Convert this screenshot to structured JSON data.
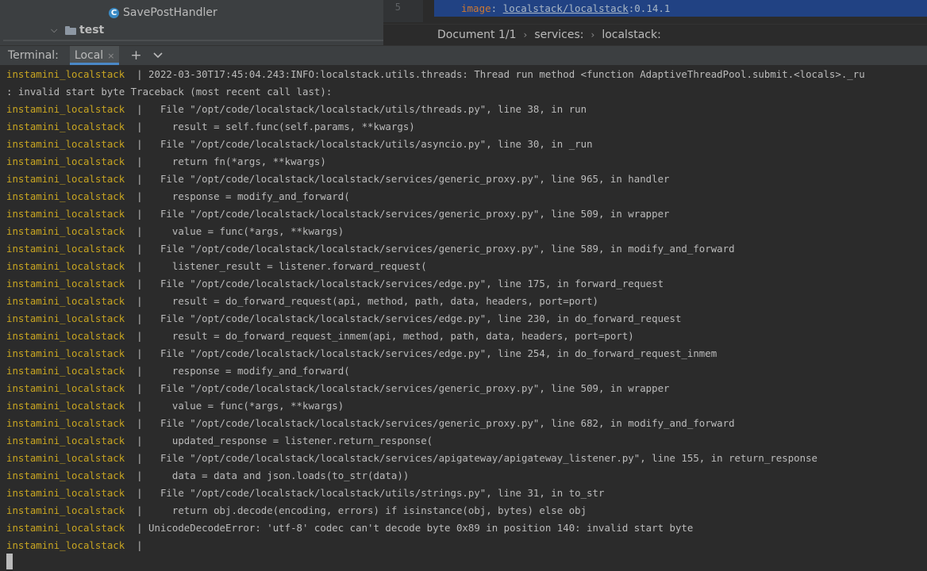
{
  "project_tree": {
    "class_item": {
      "icon": "class-icon",
      "glyph": "C",
      "label": "SavePostHandler"
    },
    "folder_item": {
      "icon": "folder-icon",
      "label": "test"
    }
  },
  "editor": {
    "line_number": "5",
    "code": {
      "key": "image",
      "colon": ":",
      "link": "localstack/localstack",
      "rest": ":0.14.1"
    },
    "breadcrumb": [
      "Document 1/1",
      "services:",
      "localstack:"
    ]
  },
  "terminal_header": {
    "title": "Terminal:",
    "tab_label": "Local",
    "close_glyph": "×",
    "add_glyph": "+",
    "dropdown_glyph": "⌄"
  },
  "colors": {
    "container_name": "#c8a521",
    "tab_underline": "#4a88c7",
    "editor_selection": "#214283"
  },
  "terminal_lines": [
    {
      "name": "instamini_localstack",
      "text": "  | 2022-03-30T17:45:04.243:INFO:localstack.utils.threads: Thread run method <function AdaptiveThreadPool.submit.<locals>._ru"
    },
    {
      "name": "",
      "text": ": invalid start byte Traceback (most recent call last):"
    },
    {
      "name": "instamini_localstack",
      "text": "  |   File \"/opt/code/localstack/localstack/utils/threads.py\", line 38, in run"
    },
    {
      "name": "instamini_localstack",
      "text": "  |     result = self.func(self.params, **kwargs)"
    },
    {
      "name": "instamini_localstack",
      "text": "  |   File \"/opt/code/localstack/localstack/utils/asyncio.py\", line 30, in _run"
    },
    {
      "name": "instamini_localstack",
      "text": "  |     return fn(*args, **kwargs)"
    },
    {
      "name": "instamini_localstack",
      "text": "  |   File \"/opt/code/localstack/localstack/services/generic_proxy.py\", line 965, in handler"
    },
    {
      "name": "instamini_localstack",
      "text": "  |     response = modify_and_forward("
    },
    {
      "name": "instamini_localstack",
      "text": "  |   File \"/opt/code/localstack/localstack/services/generic_proxy.py\", line 509, in wrapper"
    },
    {
      "name": "instamini_localstack",
      "text": "  |     value = func(*args, **kwargs)"
    },
    {
      "name": "instamini_localstack",
      "text": "  |   File \"/opt/code/localstack/localstack/services/generic_proxy.py\", line 589, in modify_and_forward"
    },
    {
      "name": "instamini_localstack",
      "text": "  |     listener_result = listener.forward_request("
    },
    {
      "name": "instamini_localstack",
      "text": "  |   File \"/opt/code/localstack/localstack/services/edge.py\", line 175, in forward_request"
    },
    {
      "name": "instamini_localstack",
      "text": "  |     result = do_forward_request(api, method, path, data, headers, port=port)"
    },
    {
      "name": "instamini_localstack",
      "text": "  |   File \"/opt/code/localstack/localstack/services/edge.py\", line 230, in do_forward_request"
    },
    {
      "name": "instamini_localstack",
      "text": "  |     result = do_forward_request_inmem(api, method, path, data, headers, port=port)"
    },
    {
      "name": "instamini_localstack",
      "text": "  |   File \"/opt/code/localstack/localstack/services/edge.py\", line 254, in do_forward_request_inmem"
    },
    {
      "name": "instamini_localstack",
      "text": "  |     response = modify_and_forward("
    },
    {
      "name": "instamini_localstack",
      "text": "  |   File \"/opt/code/localstack/localstack/services/generic_proxy.py\", line 509, in wrapper"
    },
    {
      "name": "instamini_localstack",
      "text": "  |     value = func(*args, **kwargs)"
    },
    {
      "name": "instamini_localstack",
      "text": "  |   File \"/opt/code/localstack/localstack/services/generic_proxy.py\", line 682, in modify_and_forward"
    },
    {
      "name": "instamini_localstack",
      "text": "  |     updated_response = listener.return_response("
    },
    {
      "name": "instamini_localstack",
      "text": "  |   File \"/opt/code/localstack/localstack/services/apigateway/apigateway_listener.py\", line 155, in return_response"
    },
    {
      "name": "instamini_localstack",
      "text": "  |     data = data and json.loads(to_str(data))"
    },
    {
      "name": "instamini_localstack",
      "text": "  |   File \"/opt/code/localstack/localstack/utils/strings.py\", line 31, in to_str"
    },
    {
      "name": "instamini_localstack",
      "text": "  |     return obj.decode(encoding, errors) if isinstance(obj, bytes) else obj"
    },
    {
      "name": "instamini_localstack",
      "text": "  | UnicodeDecodeError: 'utf-8' codec can't decode byte 0x89 in position 140: invalid start byte"
    },
    {
      "name": "instamini_localstack",
      "text": "  |"
    }
  ]
}
